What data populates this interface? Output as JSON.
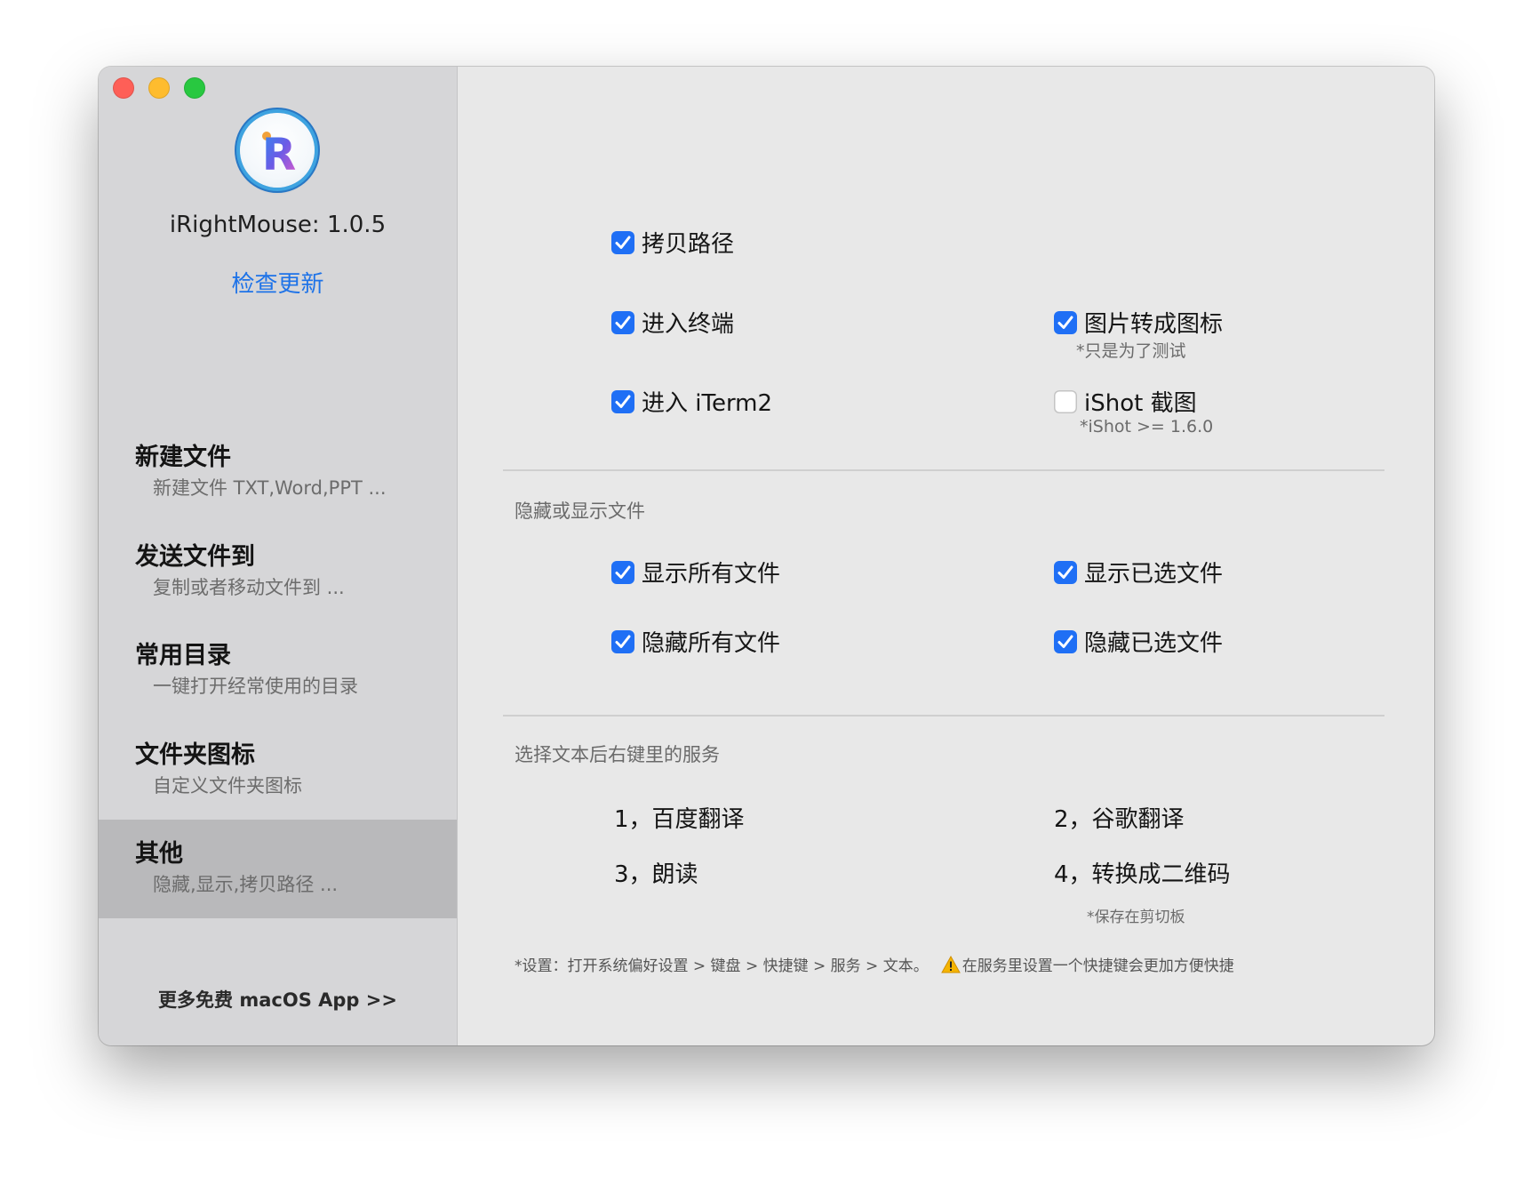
{
  "app": {
    "name_version": "iRightMouse: 1.0.5",
    "check_update": "检查更新",
    "logo_letter": "R",
    "logo_dot_letter": "i"
  },
  "sidebar": {
    "items": [
      {
        "title": "新建文件",
        "subtitle": "新建文件 TXT,Word,PPT ..."
      },
      {
        "title": "发送文件到",
        "subtitle": "复制或者移动文件到 ..."
      },
      {
        "title": "常用目录",
        "subtitle": "一键打开经常使用的目录"
      },
      {
        "title": "文件夹图标",
        "subtitle": "自定义文件夹图标"
      },
      {
        "title": "其他",
        "subtitle": "隐藏,显示,拷贝路径 ...",
        "selected": true
      }
    ],
    "more_apps": "更多免费 macOS App >>"
  },
  "options": {
    "copy_path": {
      "label": "拷贝路径",
      "checked": true
    },
    "open_terminal": {
      "label": "进入终端",
      "checked": true
    },
    "open_iterm2": {
      "label": "进入 iTerm2",
      "checked": true
    },
    "image_to_icon": {
      "label": "图片转成图标",
      "checked": true,
      "note": "*只是为了测试"
    },
    "ishot": {
      "label": "iShot 截图",
      "checked": false,
      "note": "*iShot  >=  1.6.0"
    }
  },
  "hide_show": {
    "section_title": "隐藏或显示文件",
    "show_all": {
      "label": "显示所有文件",
      "checked": true
    },
    "show_selected": {
      "label": "显示已选文件",
      "checked": true
    },
    "hide_all": {
      "label": "隐藏所有文件",
      "checked": true
    },
    "hide_selected": {
      "label": "隐藏已选文件",
      "checked": true
    }
  },
  "services": {
    "section_title": "选择文本后右键里的服务",
    "items": [
      "1，百度翻译",
      "2，谷歌翻译",
      "3，朗读",
      "4，转换成二维码"
    ],
    "qr_note": "*保存在剪切板",
    "footnote_prefix": "*设置：打开系统偏好设置 > 键盘 > 快捷键 > 服务 > 文本。",
    "footnote_warning": "在服务里设置一个快捷键会更加方便快捷"
  },
  "colors": {
    "accent": "#1f6ff5",
    "link": "#1e73e8",
    "sidebar_bg": "#d6d6d8",
    "selected_bg": "#b9b9bb",
    "content_bg": "#e8e8e8"
  },
  "icons": {
    "close": "close-dot-icon",
    "minimize": "minimize-dot-icon",
    "maximize": "maximize-dot-icon",
    "checkmark": "checkmark-icon",
    "warning": "warning-icon"
  }
}
